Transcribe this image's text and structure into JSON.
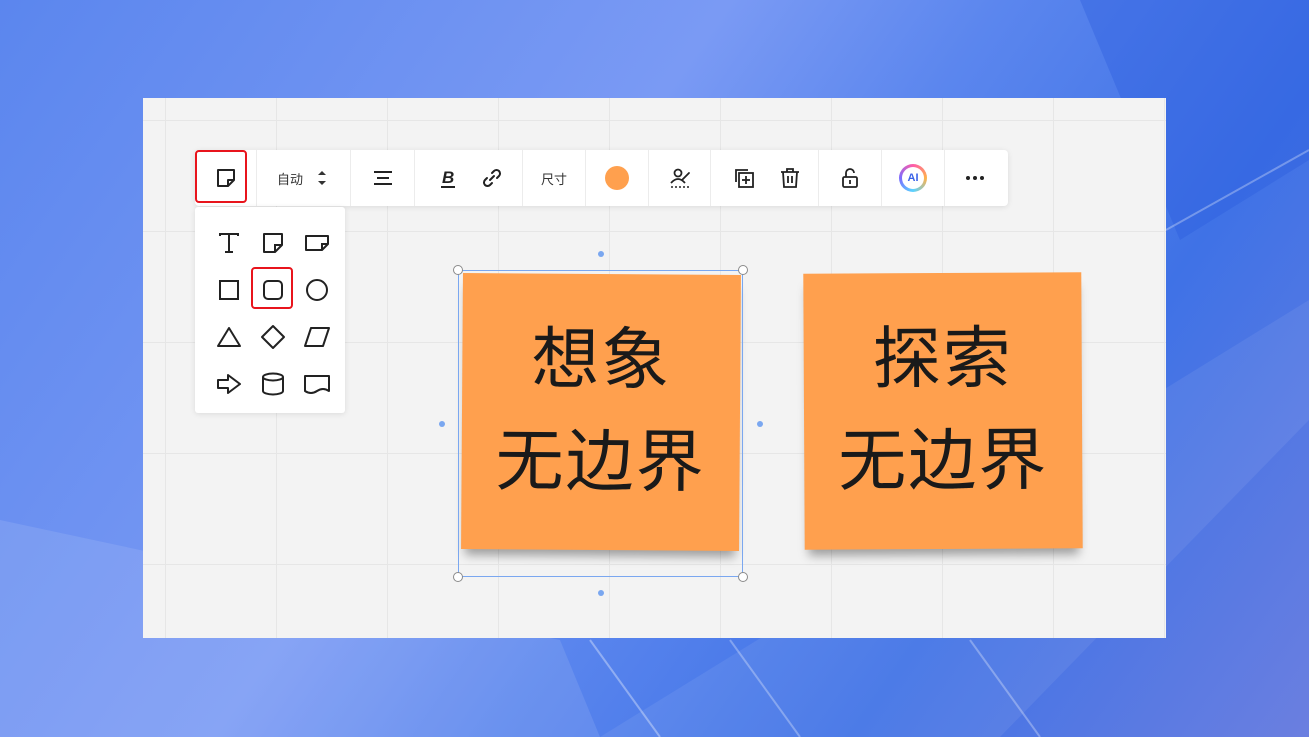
{
  "toolbar": {
    "font_size_mode": "自动",
    "size_label": "尺寸",
    "ai_label": "AI",
    "fill_color": "#ffa04e",
    "icons": [
      "sticky-note-icon",
      "font-size-stepper-icon",
      "align-center-icon",
      "bold-icon",
      "link-icon",
      "fill-color-icon",
      "border-style-icon",
      "duplicate-icon",
      "delete-icon",
      "lock-icon",
      "ai-icon",
      "more-icon"
    ]
  },
  "shape_panel": {
    "shapes": [
      "text-icon",
      "sticky-note-icon",
      "sticky-note-wide-icon",
      "rectangle-icon",
      "rounded-rectangle-icon",
      "circle-icon",
      "triangle-icon",
      "diamond-icon",
      "parallelogram-icon",
      "arrow-icon",
      "cylinder-icon",
      "banner-icon"
    ],
    "selected": "rounded-rectangle-icon"
  },
  "notes": [
    {
      "line1": "想象",
      "line2": "无边界",
      "color": "#ffa04e",
      "selected": true
    },
    {
      "line1": "探索",
      "line2": "无边界",
      "color": "#ffa04e",
      "selected": false
    }
  ],
  "colors": {
    "highlight": "#e8141c",
    "selection": "#7aa7f0",
    "canvas": "#f3f3f3"
  }
}
